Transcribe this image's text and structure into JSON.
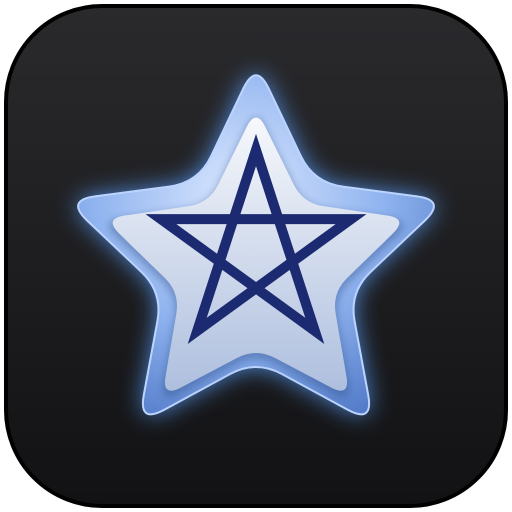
{
  "icon": {
    "name": "star-app-icon",
    "glyph": "pentagram-star-icon"
  },
  "colors": {
    "background_top": "#2a2a2d",
    "background_bottom": "#121214",
    "background_edge": "#000000",
    "glow": "#5aa0ff",
    "outer_star_light": "#dbe8ff",
    "outer_star_mid": "#8fb3ef",
    "outer_star_dark": "#4f78c6",
    "inner_star_light": "#f6f8fc",
    "inner_star_dark": "#aebfde",
    "pentagram": "#1c2a72"
  }
}
